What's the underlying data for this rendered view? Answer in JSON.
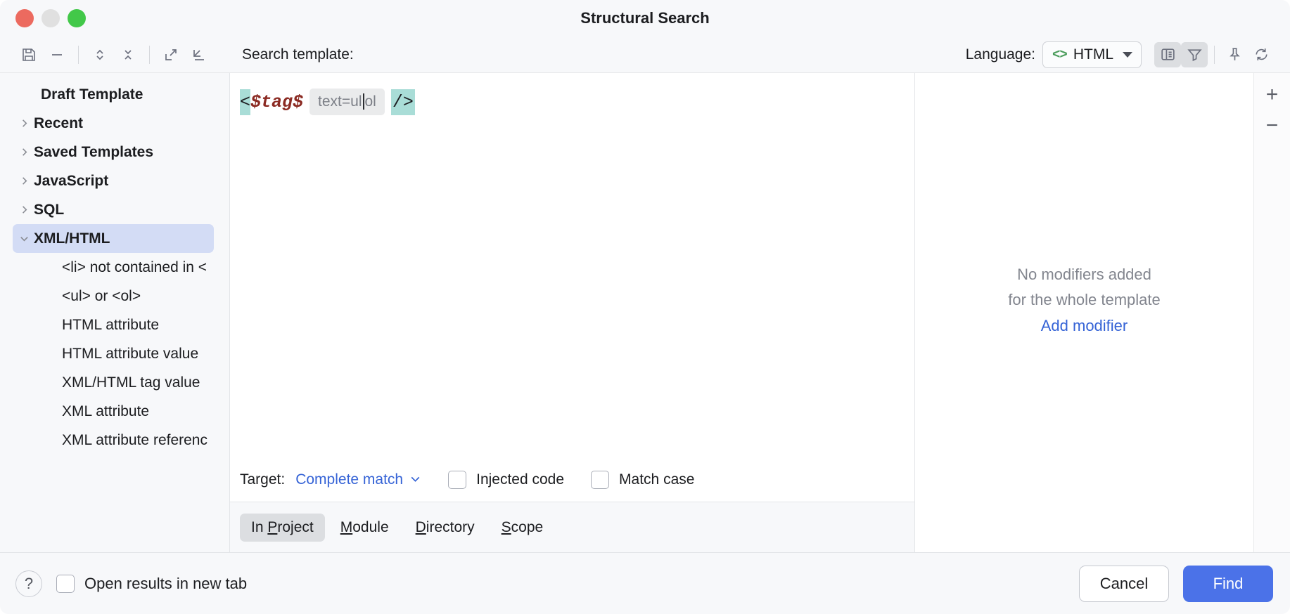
{
  "window": {
    "title": "Structural Search",
    "traffic_lights": [
      "close",
      "minimize",
      "zoom"
    ]
  },
  "toolbar": {
    "icons": [
      {
        "name": "save-template-icon",
        "glyph": "save"
      },
      {
        "name": "remove-template-icon",
        "glyph": "minus"
      },
      {
        "name": "expand-collapse-icon",
        "glyph": "chevrons-updown"
      },
      {
        "name": "collapse-all-icon",
        "glyph": "chevrons-close"
      },
      {
        "name": "export-template-icon",
        "glyph": "export"
      },
      {
        "name": "import-template-icon",
        "glyph": "import"
      }
    ],
    "search_template_label": "Search template:",
    "language_label": "Language:",
    "language_value": "HTML",
    "language_icon": "code-brackets-icon",
    "right_icons": [
      {
        "name": "toggle-modifiers-panel-icon",
        "active": true
      },
      {
        "name": "filter-icon",
        "active": true
      },
      {
        "name": "pin-icon",
        "active": false
      },
      {
        "name": "refresh-icon",
        "active": false
      }
    ]
  },
  "sidebar": {
    "items": [
      {
        "label": "Draft Template",
        "type": "group",
        "arrow": "none",
        "selected": false
      },
      {
        "label": "Recent",
        "type": "group",
        "arrow": "collapsed",
        "selected": false
      },
      {
        "label": "Saved Templates",
        "type": "group",
        "arrow": "collapsed",
        "selected": false
      },
      {
        "label": "JavaScript",
        "type": "group",
        "arrow": "collapsed",
        "selected": false
      },
      {
        "label": "SQL",
        "type": "group",
        "arrow": "collapsed",
        "selected": false
      },
      {
        "label": "XML/HTML",
        "type": "group",
        "arrow": "expanded",
        "selected": true
      },
      {
        "label": "<li> not contained in <",
        "type": "leaf",
        "arrow": "none",
        "selected": false
      },
      {
        "label": "<ul> or <ol>",
        "type": "leaf",
        "arrow": "none",
        "selected": false
      },
      {
        "label": "HTML attribute",
        "type": "leaf",
        "arrow": "none",
        "selected": false
      },
      {
        "label": "HTML attribute value",
        "type": "leaf",
        "arrow": "none",
        "selected": false
      },
      {
        "label": "XML/HTML tag value",
        "type": "leaf",
        "arrow": "none",
        "selected": false
      },
      {
        "label": "XML attribute",
        "type": "leaf",
        "arrow": "none",
        "selected": false
      },
      {
        "label": "XML attribute referenc",
        "type": "leaf",
        "arrow": "none",
        "selected": false
      }
    ]
  },
  "editor": {
    "open_angle": "<",
    "variable": "$tag$",
    "inline_hint_before_caret": "text=ul",
    "inline_hint_after_caret": "ol",
    "close_tag": "/>"
  },
  "target_row": {
    "label": "Target:",
    "value": "Complete match",
    "checkboxes": [
      {
        "label": "Injected code",
        "checked": false
      },
      {
        "label": "Match case",
        "checked": false
      }
    ]
  },
  "scope_tabs": [
    {
      "label": "In Project",
      "mnemonic_index": 3,
      "selected": true
    },
    {
      "label": "Module",
      "mnemonic_index": 0,
      "selected": false
    },
    {
      "label": "Directory",
      "mnemonic_index": 0,
      "selected": false
    },
    {
      "label": "Scope",
      "mnemonic_index": 0,
      "selected": false
    }
  ],
  "modifiers_panel": {
    "empty_line1": "No modifiers added",
    "empty_line2": "for the whole template",
    "add_link": "Add modifier",
    "rail_buttons": [
      {
        "name": "add-modifier-icon",
        "glyph": "+"
      },
      {
        "name": "remove-modifier-icon",
        "glyph": "−"
      }
    ]
  },
  "footer": {
    "help_glyph": "?",
    "open_results_label": "Open results in new tab",
    "open_results_checked": false,
    "cancel_label": "Cancel",
    "find_label": "Find"
  },
  "colors": {
    "accent_blue": "#4b72e8",
    "link_blue": "#3563d6",
    "selection_lavender": "#d3dcf5",
    "template_var_red": "#8b2a22",
    "highlight_teal": "#a9ddd7",
    "lang_icon_green": "#4a9c5b"
  }
}
